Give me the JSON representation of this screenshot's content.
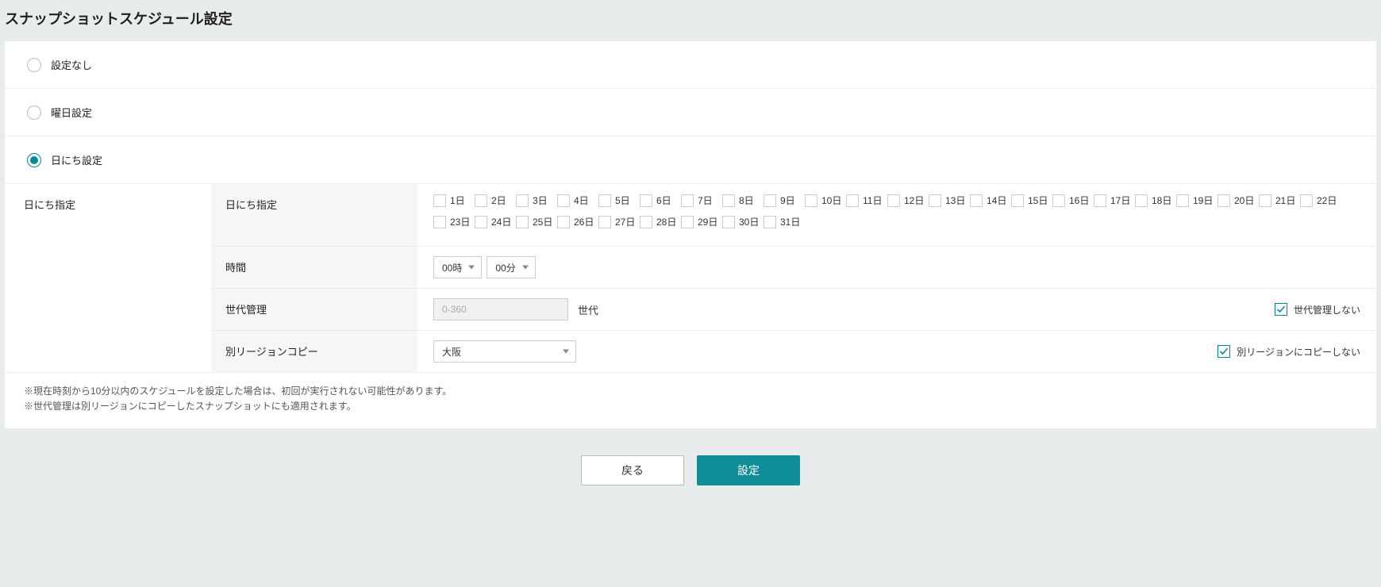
{
  "page": {
    "title": "スナップショットスケジュール設定"
  },
  "radios": {
    "none": "設定なし",
    "weekday": "曜日設定",
    "date": "日にち設定",
    "selected": "date"
  },
  "section": {
    "label": "日にち指定"
  },
  "rows": {
    "days_label": "日にち指定",
    "time_label": "時間",
    "gen_label": "世代管理",
    "region_label": "別リージョンコピー"
  },
  "days": [
    "1日",
    "2日",
    "3日",
    "4日",
    "5日",
    "6日",
    "7日",
    "8日",
    "9日",
    "10日",
    "11日",
    "12日",
    "13日",
    "14日",
    "15日",
    "16日",
    "17日",
    "18日",
    "19日",
    "20日",
    "21日",
    "22日",
    "23日",
    "24日",
    "25日",
    "26日",
    "27日",
    "28日",
    "29日",
    "30日",
    "31日"
  ],
  "time": {
    "hour": "00時",
    "minute": "00分"
  },
  "generations": {
    "placeholder": "0-360",
    "suffix": "世代",
    "checkbox_label": "世代管理しない"
  },
  "region": {
    "selected": "大阪",
    "checkbox_label": "別リージョンにコピーしない"
  },
  "notes": {
    "n1": "※現在時刻から10分以内のスケジュールを設定した場合は、初回が実行されない可能性があります。",
    "n2": "※世代管理は別リージョンにコピーしたスナップショットにも適用されます。"
  },
  "footer": {
    "back": "戻る",
    "submit": "設定"
  },
  "colors": {
    "accent": "#0f8d99"
  }
}
